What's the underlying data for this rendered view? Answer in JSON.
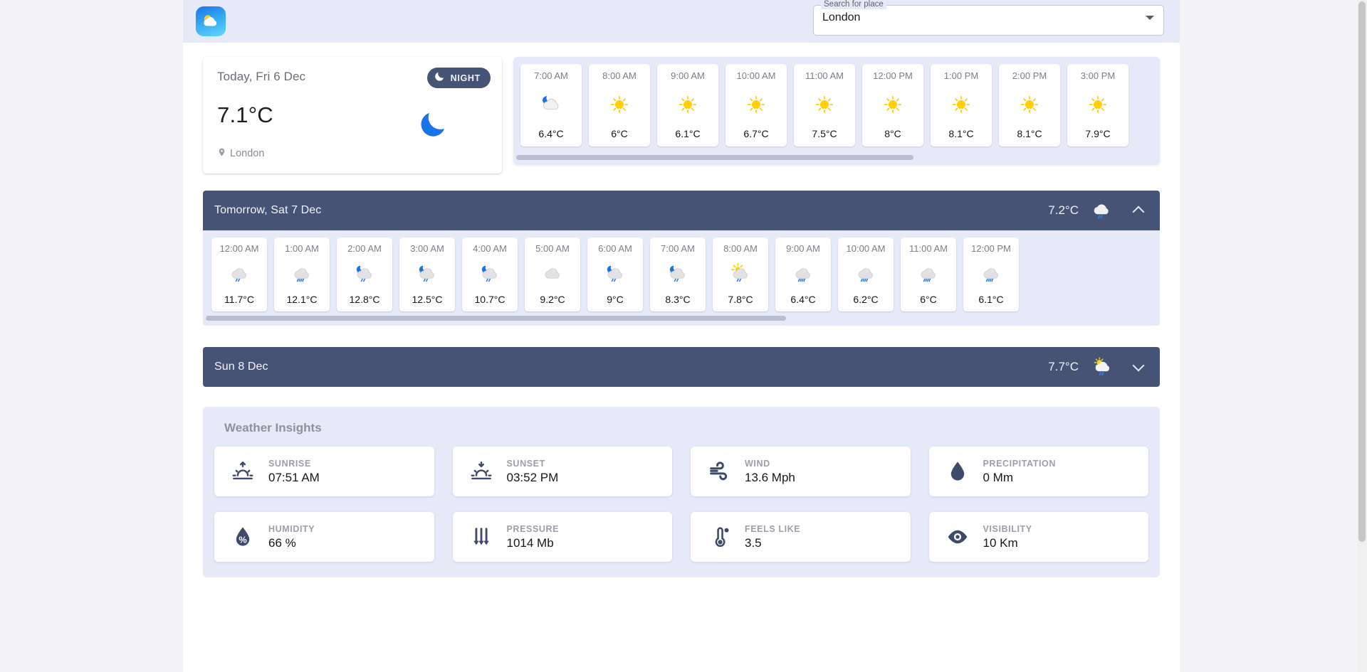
{
  "header": {
    "logo_icon": "sun-cloud-logo-icon",
    "search": {
      "label": "Search for place",
      "value": "London",
      "placeholder": "Search for place"
    }
  },
  "today": {
    "date": "Today, Fri 6 Dec",
    "badge": "NIGHT",
    "badge_icon": "moon-icon",
    "temp": "7.1°C",
    "icon": "moon-icon",
    "location": "London",
    "location_icon": "location-pin-icon"
  },
  "today_hourly": {
    "hours": [
      {
        "time": "7:00 AM",
        "temp": "6.4°C",
        "icon": "moon-cloud"
      },
      {
        "time": "8:00 AM",
        "temp": "6°C",
        "icon": "sun"
      },
      {
        "time": "9:00 AM",
        "temp": "6.1°C",
        "icon": "sun"
      },
      {
        "time": "10:00 AM",
        "temp": "6.7°C",
        "icon": "sun"
      },
      {
        "time": "11:00 AM",
        "temp": "7.5°C",
        "icon": "sun"
      },
      {
        "time": "12:00 PM",
        "temp": "8°C",
        "icon": "sun"
      },
      {
        "time": "1:00 PM",
        "temp": "8.1°C",
        "icon": "sun"
      },
      {
        "time": "2:00 PM",
        "temp": "8.1°C",
        "icon": "sun"
      },
      {
        "time": "3:00 PM",
        "temp": "7.9°C",
        "icon": "sun"
      }
    ],
    "scroll_percent": 62
  },
  "days": [
    {
      "title": "Tomorrow, Sat 7 Dec",
      "temp": "7.2°C",
      "icon": "cloud-rain",
      "expanded": true,
      "chevron": "chevron-up-icon",
      "scroll_percent": 61,
      "hours": [
        {
          "time": "12:00 AM",
          "temp": "11.7°C",
          "icon": "cloud-rain"
        },
        {
          "time": "1:00 AM",
          "temp": "12.1°C",
          "icon": "cloud-rain-heavy"
        },
        {
          "time": "2:00 AM",
          "temp": "12.8°C",
          "icon": "moon-cloud-rain"
        },
        {
          "time": "3:00 AM",
          "temp": "12.5°C",
          "icon": "moon-cloud-rain"
        },
        {
          "time": "4:00 AM",
          "temp": "10.7°C",
          "icon": "moon-cloud-rain"
        },
        {
          "time": "5:00 AM",
          "temp": "9.2°C",
          "icon": "cloud"
        },
        {
          "time": "6:00 AM",
          "temp": "9°C",
          "icon": "moon-cloud-rain"
        },
        {
          "time": "7:00 AM",
          "temp": "8.3°C",
          "icon": "moon-cloud-rain"
        },
        {
          "time": "8:00 AM",
          "temp": "7.8°C",
          "icon": "sun-cloud-rain"
        },
        {
          "time": "9:00 AM",
          "temp": "6.4°C",
          "icon": "cloud-rain-heavy"
        },
        {
          "time": "10:00 AM",
          "temp": "6.2°C",
          "icon": "cloud-rain-heavy"
        },
        {
          "time": "11:00 AM",
          "temp": "6°C",
          "icon": "cloud-rain-heavy"
        },
        {
          "time": "12:00 PM",
          "temp": "6.1°C",
          "icon": "cloud-rain-heavy"
        }
      ]
    },
    {
      "title": "Sun 8 Dec",
      "temp": "7.7°C",
      "icon": "sun-cloud-rain",
      "expanded": false,
      "chevron": "chevron-down-icon",
      "hours": []
    }
  ],
  "insights": {
    "title": "Weather Insights",
    "cards": [
      {
        "icon": "sunrise-icon",
        "label": "SUNRISE",
        "value": "07:51 AM"
      },
      {
        "icon": "sunset-icon",
        "label": "SUNSET",
        "value": "03:52 PM"
      },
      {
        "icon": "wind-icon",
        "label": "WIND",
        "value": "13.6 Mph"
      },
      {
        "icon": "precipitation-icon",
        "label": "PRECIPITATION",
        "value": "0 Mm"
      },
      {
        "icon": "humidity-icon",
        "label": "HUMIDITY",
        "value": "66 %"
      },
      {
        "icon": "pressure-icon",
        "label": "PRESSURE",
        "value": "1014 Mb"
      },
      {
        "icon": "feels-like-icon",
        "label": "FEELS LIKE",
        "value": "3.5"
      },
      {
        "icon": "visibility-icon",
        "label": "VISIBILITY",
        "value": "10 Km"
      }
    ]
  },
  "colors": {
    "panel_bg": "#e6e9f7",
    "daybar_bg": "#475375",
    "accent_blue": "#1a73e8",
    "sun_yellow": "#ffd000",
    "rain_blue": "#2f7ee0",
    "cloud_gray": "#d8d8da"
  }
}
